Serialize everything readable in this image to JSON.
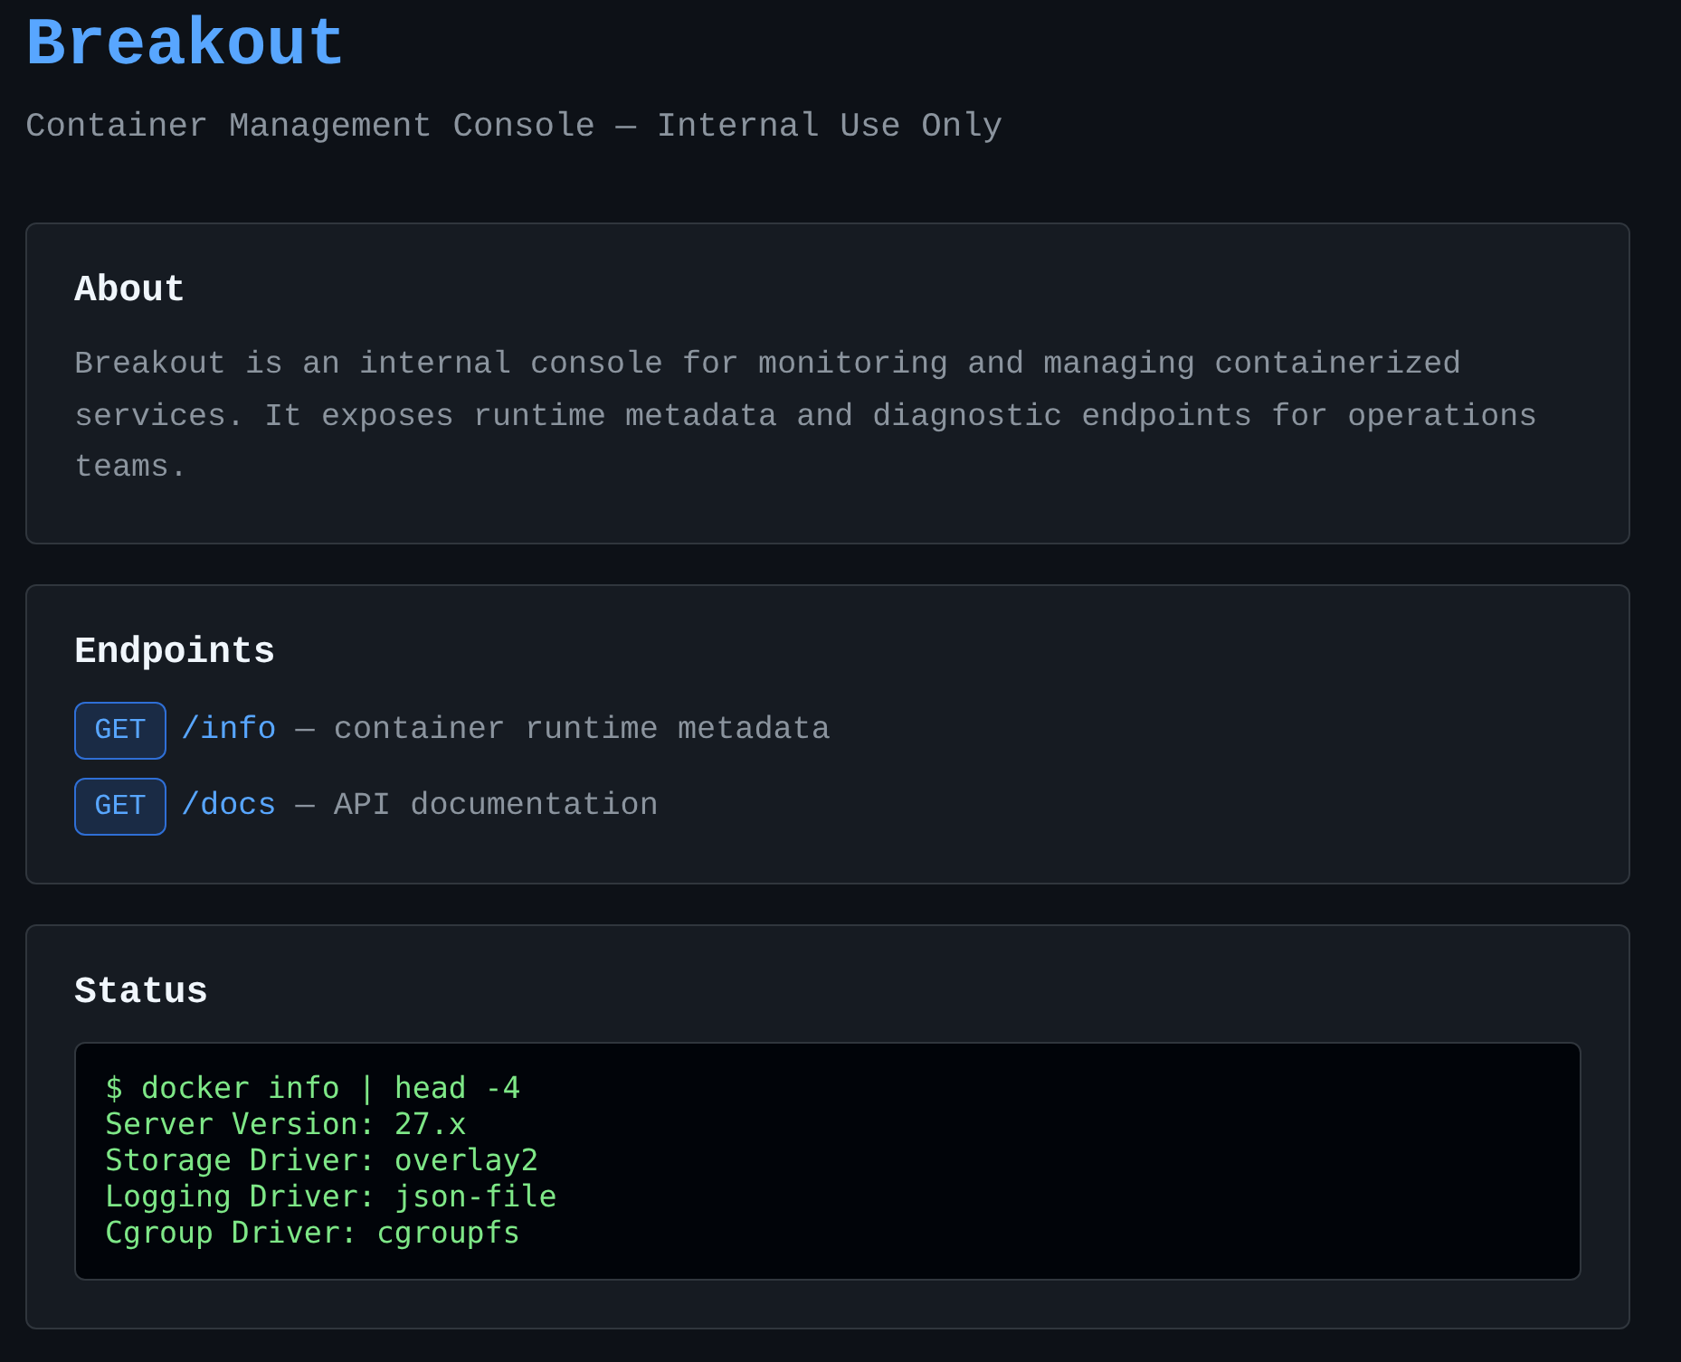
{
  "header": {
    "title": "Breakout",
    "subtitle": "Container Management Console — Internal Use Only"
  },
  "about": {
    "heading": "About",
    "text": "Breakout is an internal console for monitoring and managing containerized services. It exposes runtime metadata and diagnostic endpoints for operations teams."
  },
  "endpoints": {
    "heading": "Endpoints",
    "items": [
      {
        "method": "GET",
        "path": "/info",
        "description": "— container runtime metadata"
      },
      {
        "method": "GET",
        "path": "/docs",
        "description": "— API documentation"
      }
    ]
  },
  "status": {
    "heading": "Status",
    "terminal_lines": [
      "$ docker info | head -4",
      "Server Version: 27.x",
      "Storage Driver: overlay2",
      "Logging Driver: json-file",
      "Cgroup Driver: cgroupfs"
    ]
  }
}
